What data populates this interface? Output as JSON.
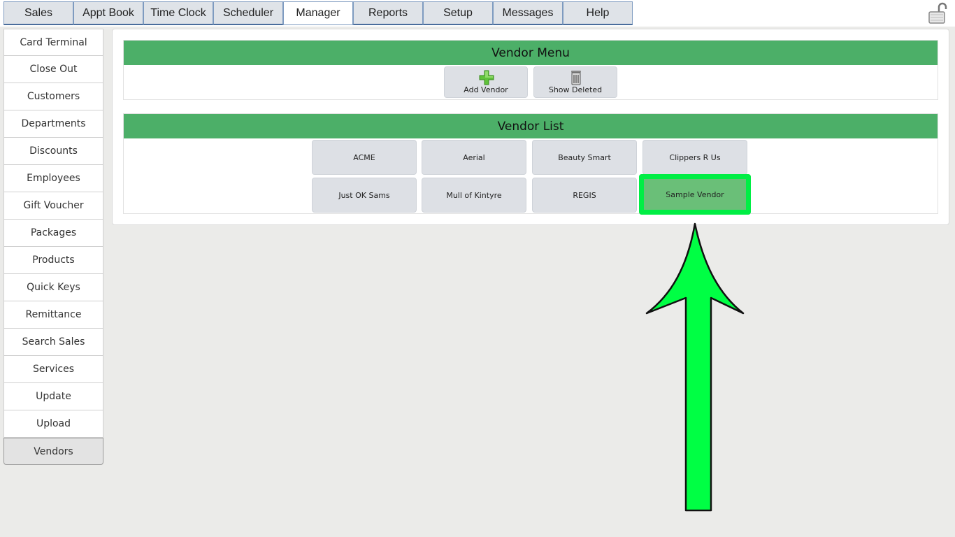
{
  "tabs": [
    {
      "label": "Sales"
    },
    {
      "label": "Appt Book"
    },
    {
      "label": "Time Clock"
    },
    {
      "label": "Scheduler"
    },
    {
      "label": "Manager"
    },
    {
      "label": "Reports"
    },
    {
      "label": "Setup"
    },
    {
      "label": "Messages"
    },
    {
      "label": "Help"
    }
  ],
  "active_tab": "Manager",
  "sidebar": {
    "items": [
      {
        "label": "Card Terminal"
      },
      {
        "label": "Close Out"
      },
      {
        "label": "Customers"
      },
      {
        "label": "Departments"
      },
      {
        "label": "Discounts"
      },
      {
        "label": "Employees"
      },
      {
        "label": "Gift Voucher"
      },
      {
        "label": "Packages"
      },
      {
        "label": "Products"
      },
      {
        "label": "Quick Keys"
      },
      {
        "label": "Remittance"
      },
      {
        "label": "Search Sales"
      },
      {
        "label": "Services"
      },
      {
        "label": "Update"
      },
      {
        "label": "Upload"
      },
      {
        "label": "Vendors"
      }
    ],
    "active": "Vendors"
  },
  "vendor_menu": {
    "title": "Vendor Menu",
    "add_label": "Add Vendor",
    "deleted_label": "Show Deleted",
    "add_icon": "green-plus-icon",
    "deleted_icon": "trash-can-icon"
  },
  "vendor_list": {
    "title": "Vendor List",
    "vendors": [
      {
        "label": "ACME"
      },
      {
        "label": "Aerial"
      },
      {
        "label": "Beauty Smart"
      },
      {
        "label": "Clippers R Us"
      },
      {
        "label": "Just OK Sams"
      },
      {
        "label": "Mull of Kintyre"
      },
      {
        "label": "REGIS"
      },
      {
        "label": "Sample Vendor"
      }
    ],
    "highlighted": "Sample Vendor"
  },
  "colors": {
    "header_green": "#4caf68",
    "highlight_green": "#00ee44",
    "arrow_green": "#00ff44"
  }
}
